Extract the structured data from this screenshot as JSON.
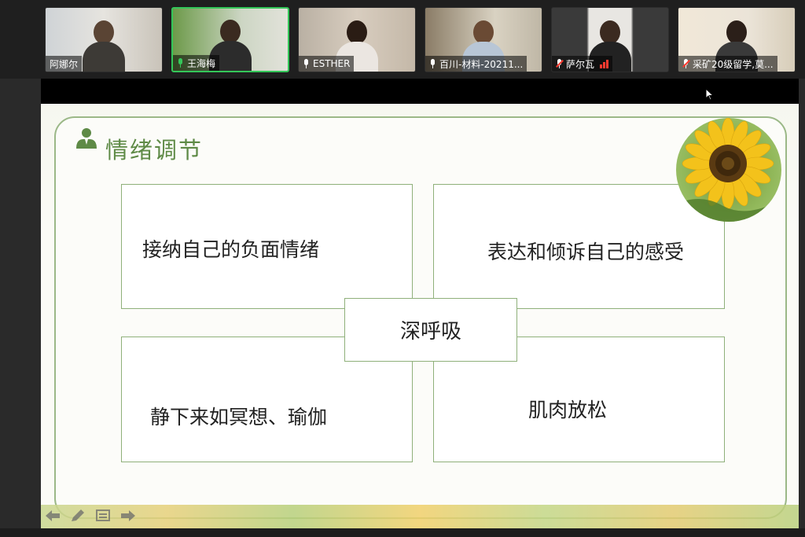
{
  "participants": [
    {
      "name": "阿娜尔",
      "mic": "none",
      "active": false
    },
    {
      "name": "王海梅",
      "mic": "on-green",
      "active": true
    },
    {
      "name": "ESTHER",
      "mic": "on",
      "active": false
    },
    {
      "name": "百川-材料-20211...",
      "mic": "on",
      "active": false
    },
    {
      "name": "萨尔瓦",
      "mic": "muted",
      "active": false
    },
    {
      "name": "采矿20级留学,莫...",
      "mic": "muted",
      "active": false
    }
  ],
  "slide": {
    "title": "情绪调节",
    "boxes": {
      "top_left": "接纳自己的负面情绪",
      "top_right": "表达和倾诉自己的感受",
      "center": "深呼吸",
      "bottom_left": "静下来如冥想、瑜伽",
      "bottom_right": "肌肉放松"
    }
  },
  "colors": {
    "accent_green": "#5e8a46",
    "border_green": "#8fb07a",
    "active_speaker": "#34c759",
    "muted_red": "#ff3b30"
  },
  "icons": {
    "title": "person-group-icon",
    "controls": [
      "arrow-left-icon",
      "pen-icon",
      "screen-icon",
      "arrow-right-icon"
    ]
  }
}
